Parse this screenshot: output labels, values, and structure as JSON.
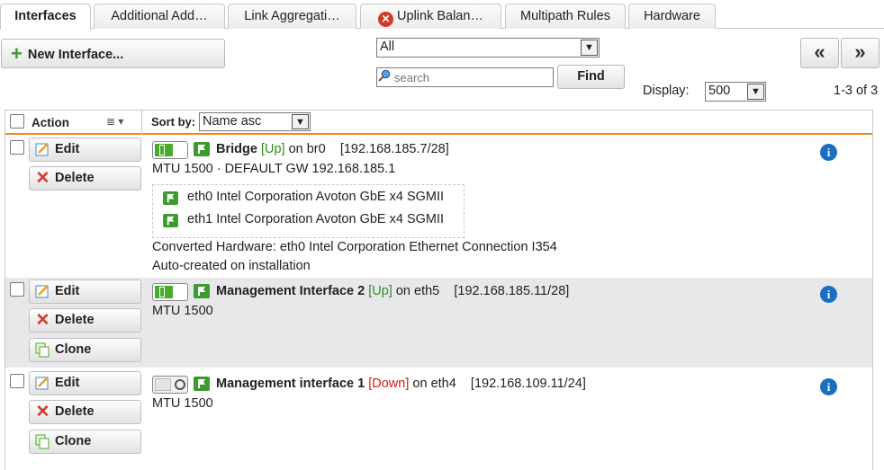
{
  "tabs": [
    {
      "label": "Interfaces",
      "active": true
    },
    {
      "label": "Additional Add…",
      "active": false
    },
    {
      "label": "Link Aggregati…",
      "active": false
    },
    {
      "label": "Uplink Balan…",
      "active": false,
      "warning": true
    },
    {
      "label": "Multipath Rules",
      "active": false
    },
    {
      "label": "Hardware",
      "active": false
    }
  ],
  "toolbar": {
    "new_label": "New Interface...",
    "filter_value": "All",
    "search_placeholder": "search",
    "find_label": "Find",
    "prev_label": "«",
    "next_label": "»",
    "display_label": "Display:",
    "display_value": "500",
    "count": "1-3 of 3"
  },
  "grid": {
    "action_header": "Action",
    "sort_label": "Sort by:",
    "sort_value": "Name asc"
  },
  "buttons": {
    "edit": "Edit",
    "delete": "Delete",
    "clone": "Clone"
  },
  "rows": [
    {
      "name": "Bridge",
      "status": "[Up]",
      "on": "on br0",
      "address": "[192.168.185.7/28]",
      "detail": "MTU 1500 · DEFAULT GW 192.168.185.1",
      "members": [
        "eth0 Intel Corporation Avoton GbE x4 SGMII",
        "eth1 Intel Corporation Avoton GbE x4 SGMII"
      ],
      "note1": "Converted Hardware: eth0 Intel Corporation Ethernet Connection I354",
      "note2": "Auto-created on installation",
      "enabled": true
    },
    {
      "name": "Management Interface 2",
      "status": "[Up]",
      "on": "on eth5",
      "address": "[192.168.185.11/28]",
      "detail": "MTU 1500",
      "enabled": true
    },
    {
      "name": "Management interface 1",
      "status": "[Down]",
      "on": "on eth4",
      "address": "[192.168.109.11/24]",
      "detail": "MTU 1500",
      "enabled": false
    }
  ],
  "colors": {
    "accent": "#f08a1e",
    "up": "#2f8f1f",
    "down": "#d0201a",
    "info": "#1a6fc2",
    "toggle_on": "#4aaa2e"
  }
}
